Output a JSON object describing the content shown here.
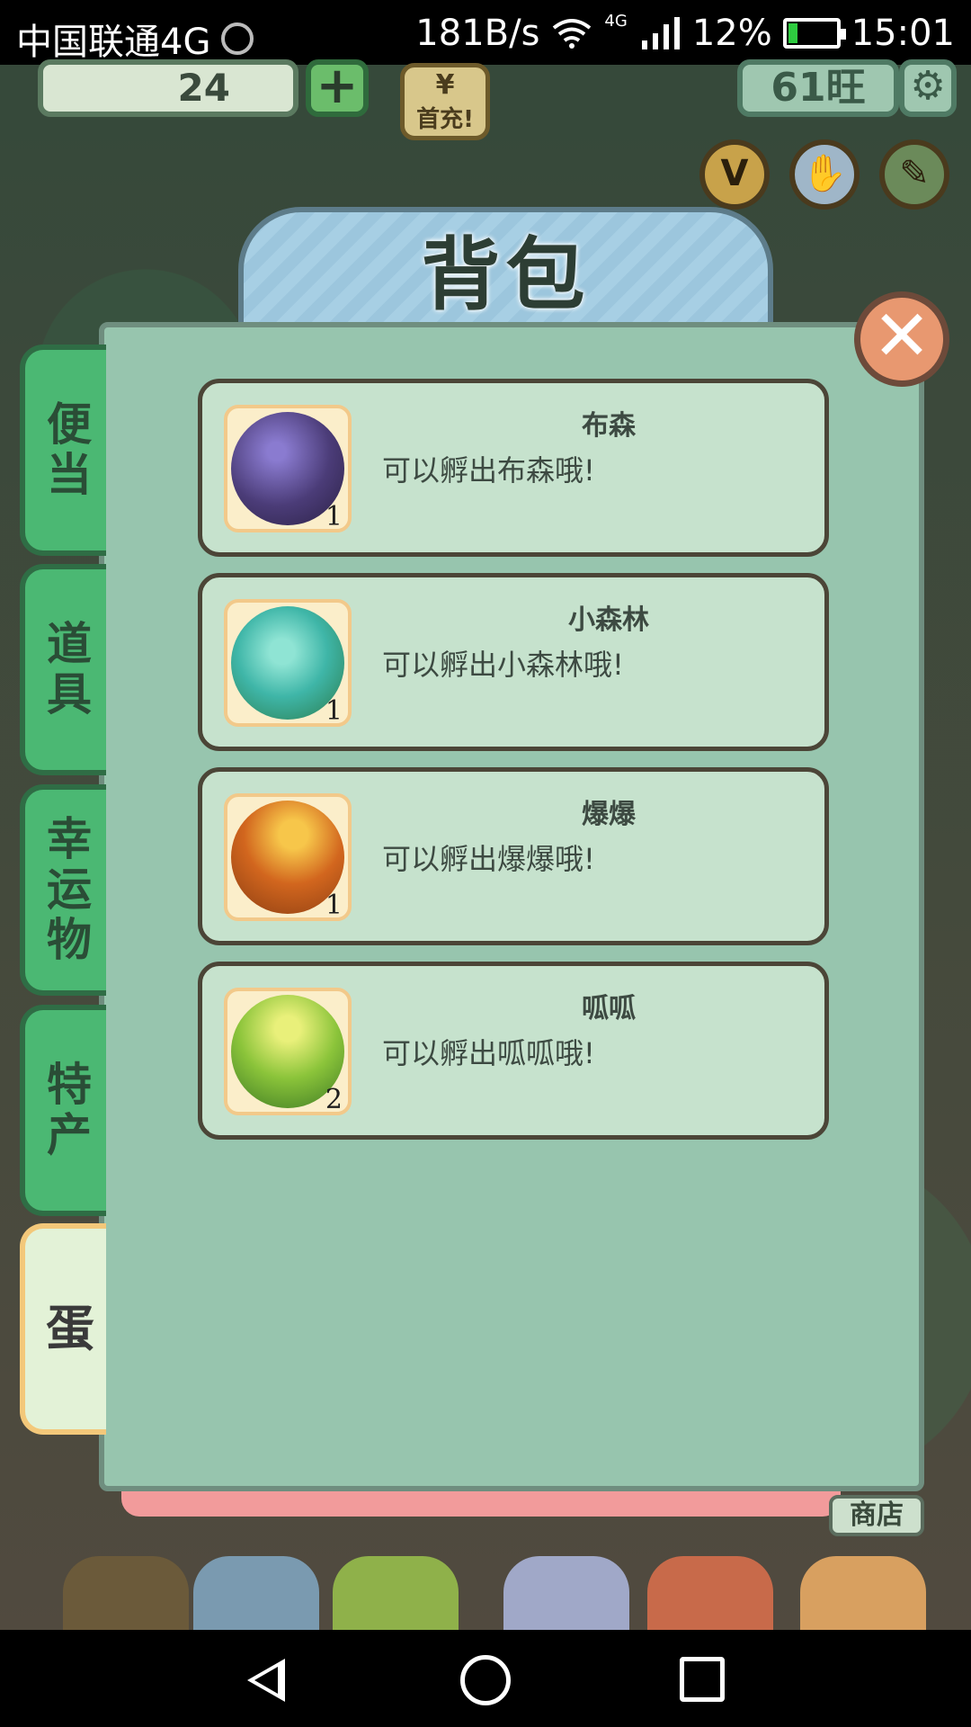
{
  "status_bar": {
    "carrier": "中国联通4G",
    "speed": "181B/s",
    "network": "4G",
    "battery": "12%",
    "time": "15:01",
    "icons": [
      "qq-icon",
      "wifi-icon",
      "signal-icon",
      "battery-icon"
    ]
  },
  "hud": {
    "coins": "24",
    "first_charge": "首充!",
    "yen_symbol": "¥",
    "wang": "61旺",
    "plus": "+",
    "side_buttons": [
      "V",
      "✋",
      "✎"
    ]
  },
  "bag": {
    "title": "背包",
    "close": "✕",
    "tabs": [
      {
        "label": "便当",
        "active": false
      },
      {
        "label": "道具",
        "active": false
      },
      {
        "label": "幸运物",
        "active": false
      },
      {
        "label": "特产",
        "active": false
      },
      {
        "label": "蛋",
        "active": true
      }
    ],
    "items": [
      {
        "name": "布森",
        "desc": "可以孵出布森哦!",
        "qty": "1",
        "color": "#4b3c78"
      },
      {
        "name": "小森林",
        "desc": "可以孵出小森林哦!",
        "qty": "1",
        "color": "#3fb6a8"
      },
      {
        "name": "爆爆",
        "desc": "可以孵出爆爆哦!",
        "qty": "1",
        "color": "#d2661e"
      },
      {
        "name": "呱呱",
        "desc": "可以孵出呱呱哦!",
        "qty": "2",
        "color": "#8bc43a"
      }
    ]
  },
  "shop": {
    "label": "商店"
  },
  "nav": {
    "back": "back-icon",
    "home": "home-icon",
    "recent": "recent-icon"
  }
}
